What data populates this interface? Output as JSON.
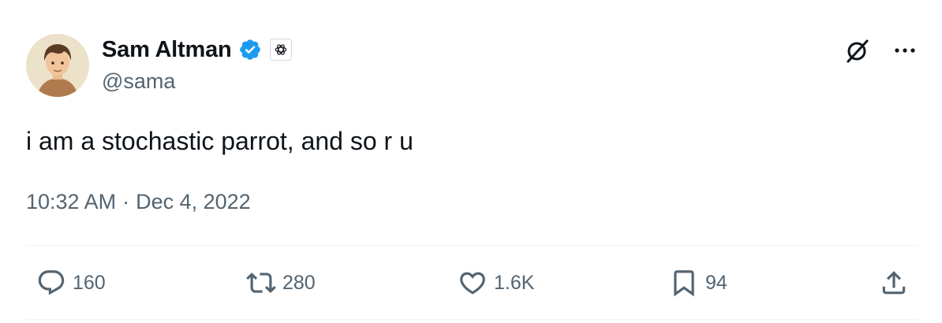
{
  "author": {
    "name": "Sam Altman",
    "handle": "@sama",
    "verified": true,
    "affiliation_badge": "openai-logo-icon"
  },
  "tweet": {
    "text": "i am a stochastic parrot, and so r u",
    "time": "10:32 AM",
    "separator": "·",
    "date": "Dec 4, 2022"
  },
  "header_actions": [
    "grok-icon",
    "more-options-icon"
  ],
  "actions": {
    "replies": "160",
    "reposts": "280",
    "likes": "1.6K",
    "bookmarks": "94"
  },
  "colors": {
    "text_primary": "#0f1419",
    "text_secondary": "#536471",
    "verified_blue": "#1d9bf0",
    "divider": "#eff3f4"
  }
}
